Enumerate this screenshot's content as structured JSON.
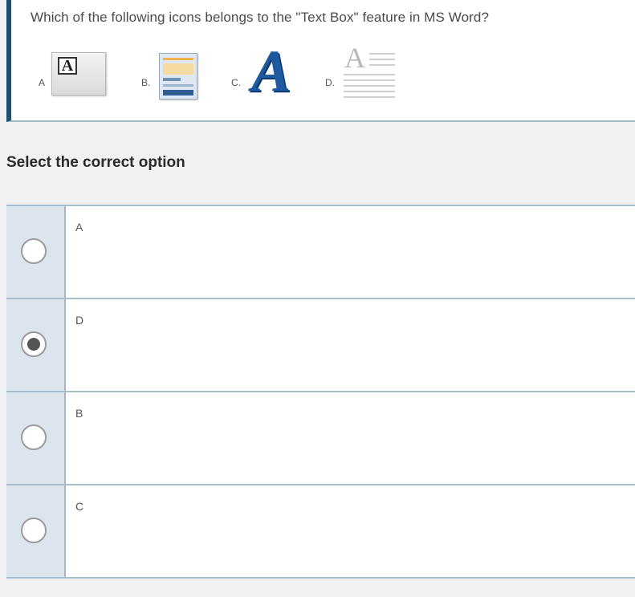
{
  "question": {
    "text": "Which of the following icons belongs to the \"Text Box\" feature in MS Word?",
    "option_labels": [
      "A",
      "B.",
      "C.",
      "D."
    ],
    "icons": [
      "text-box-a-icon",
      "quick-parts-page-icon",
      "wordart-a-icon",
      "text-align-a-icon"
    ],
    "icon_a_letter": "A",
    "icon_c_letter": "A",
    "icon_d_letter": "A"
  },
  "prompt": "Select the correct option",
  "choices": [
    {
      "label": "A",
      "selected": false
    },
    {
      "label": "D",
      "selected": true
    },
    {
      "label": "B",
      "selected": false
    },
    {
      "label": "C",
      "selected": false
    }
  ],
  "colors": {
    "accent_bar": "#1f4f73",
    "row_gutter": "#dce5ee",
    "divider": "#a8c0ce"
  }
}
